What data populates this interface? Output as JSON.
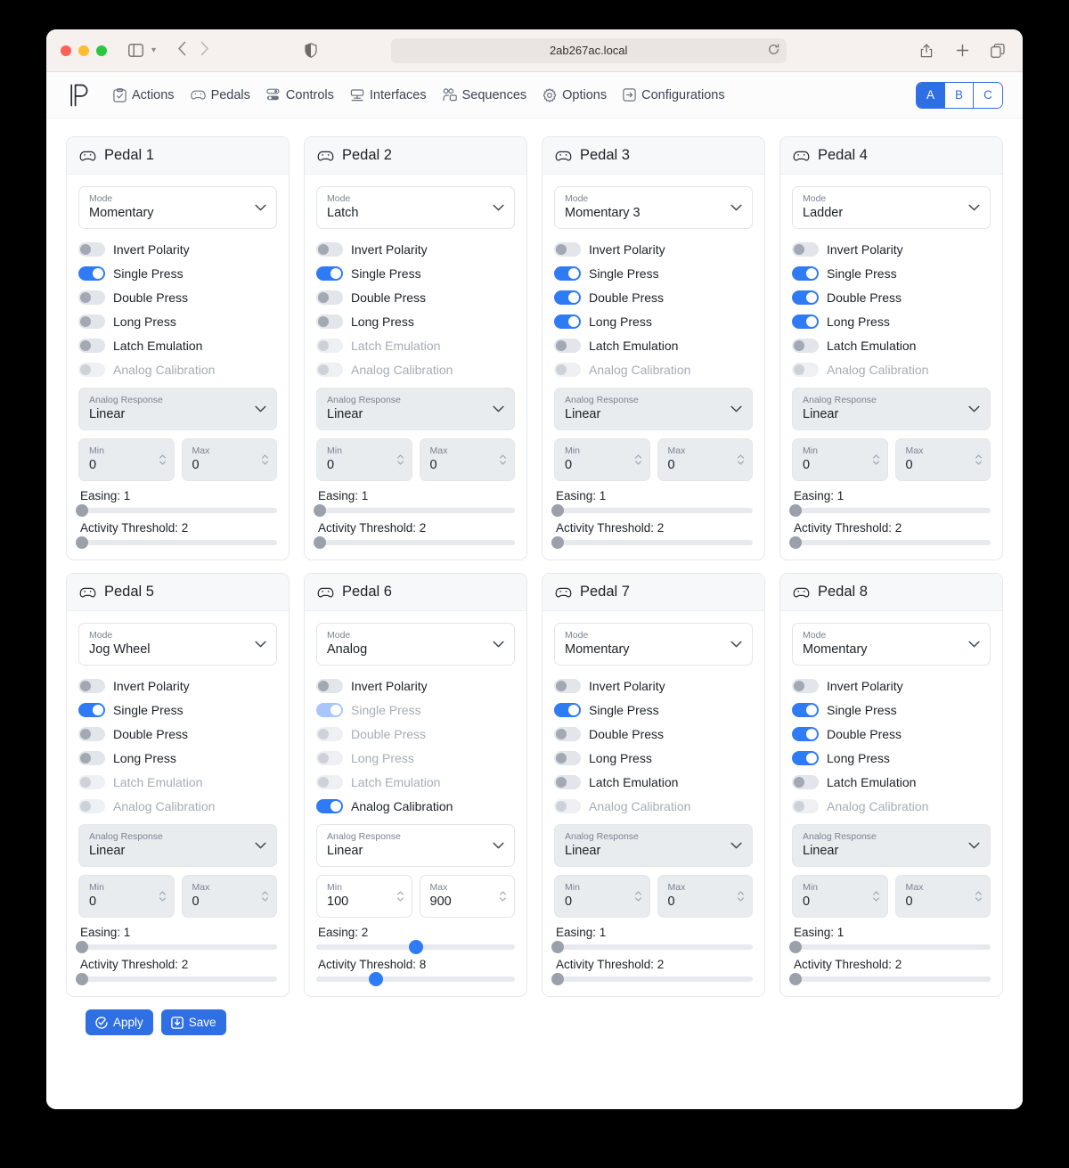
{
  "browser": {
    "url": "2ab267ac.local",
    "icons": {
      "sidebar": "sidebar-icon",
      "sidebar_chevron": "chevron-down-icon",
      "back": "back-arrow-icon",
      "forward": "forward-arrow-icon",
      "shield": "shield-icon",
      "reload": "reload-icon",
      "share": "share-icon",
      "new_tab": "plus-icon",
      "tabs": "tab-overview-icon"
    }
  },
  "nav": {
    "logo": "p-logo",
    "items": [
      {
        "label": "Actions",
        "icon": "clipboard-check-icon"
      },
      {
        "label": "Pedals",
        "icon": "gamepad-icon"
      },
      {
        "label": "Controls",
        "icon": "sliders-icon"
      },
      {
        "label": "Interfaces",
        "icon": "network-icon"
      },
      {
        "label": "Sequences",
        "icon": "video-stack-icon"
      },
      {
        "label": "Options",
        "icon": "gear-icon"
      },
      {
        "label": "Configurations",
        "icon": "chip-icon"
      }
    ],
    "configs": [
      {
        "label": "A",
        "active": true
      },
      {
        "label": "B",
        "active": false
      },
      {
        "label": "C",
        "active": false
      }
    ]
  },
  "labels": {
    "mode": "Mode",
    "analog_response": "Analog Response",
    "min": "Min",
    "max": "Max",
    "invert_polarity": "Invert Polarity",
    "single_press": "Single Press",
    "double_press": "Double Press",
    "long_press": "Long Press",
    "latch_emulation": "Latch Emulation",
    "analog_calibration": "Analog Calibration",
    "easing_prefix": "Easing",
    "activity_prefix": "Activity Threshold"
  },
  "footer": {
    "apply_label": "Apply",
    "apply_icon": "check-circle-icon",
    "save_label": "Save",
    "save_icon": "save-download-icon"
  },
  "colors": {
    "accent": "#2f6fe4",
    "toggle_on": "#2f7bf6",
    "toggle_off": "#e2e5ea",
    "card_border": "#e6e8eb",
    "card_header_bg": "#f7f8f9"
  },
  "pedals": [
    {
      "title": "Pedal 1",
      "icon": "gamepad-icon",
      "mode": "Momentary",
      "mode_enabled": true,
      "toggles": [
        {
          "key": "invert_polarity",
          "label": "Invert Polarity",
          "on": false,
          "enabled": true
        },
        {
          "key": "single_press",
          "label": "Single Press",
          "on": true,
          "enabled": true
        },
        {
          "key": "double_press",
          "label": "Double Press",
          "on": false,
          "enabled": true
        },
        {
          "key": "long_press",
          "label": "Long Press",
          "on": false,
          "enabled": true
        },
        {
          "key": "latch_emulation",
          "label": "Latch Emulation",
          "on": false,
          "enabled": true
        },
        {
          "key": "analog_calibration",
          "label": "Analog Calibration",
          "on": false,
          "enabled": false
        }
      ],
      "analog_response": "Linear",
      "analog_response_enabled": false,
      "min": "0",
      "max": "0",
      "minmax_enabled": false,
      "easing": 1,
      "easing_label": "Easing: 1",
      "easing_pct": 2,
      "easing_active": false,
      "activity": 2,
      "activity_label": "Activity Threshold: 2",
      "activity_pct": 2,
      "activity_active": false
    },
    {
      "title": "Pedal 2",
      "icon": "gamepad-icon",
      "mode": "Latch",
      "mode_enabled": true,
      "toggles": [
        {
          "key": "invert_polarity",
          "label": "Invert Polarity",
          "on": false,
          "enabled": true
        },
        {
          "key": "single_press",
          "label": "Single Press",
          "on": true,
          "enabled": true
        },
        {
          "key": "double_press",
          "label": "Double Press",
          "on": false,
          "enabled": true
        },
        {
          "key": "long_press",
          "label": "Long Press",
          "on": false,
          "enabled": true
        },
        {
          "key": "latch_emulation",
          "label": "Latch Emulation",
          "on": false,
          "enabled": false
        },
        {
          "key": "analog_calibration",
          "label": "Analog Calibration",
          "on": false,
          "enabled": false
        }
      ],
      "analog_response": "Linear",
      "analog_response_enabled": false,
      "min": "0",
      "max": "0",
      "minmax_enabled": false,
      "easing": 1,
      "easing_label": "Easing: 1",
      "easing_pct": 2,
      "easing_active": false,
      "activity": 2,
      "activity_label": "Activity Threshold: 2",
      "activity_pct": 2,
      "activity_active": false
    },
    {
      "title": "Pedal 3",
      "icon": "gamepad-icon",
      "mode": "Momentary 3",
      "mode_enabled": true,
      "toggles": [
        {
          "key": "invert_polarity",
          "label": "Invert Polarity",
          "on": false,
          "enabled": true
        },
        {
          "key": "single_press",
          "label": "Single Press",
          "on": true,
          "enabled": true
        },
        {
          "key": "double_press",
          "label": "Double Press",
          "on": true,
          "enabled": true
        },
        {
          "key": "long_press",
          "label": "Long Press",
          "on": true,
          "enabled": true
        },
        {
          "key": "latch_emulation",
          "label": "Latch Emulation",
          "on": false,
          "enabled": true
        },
        {
          "key": "analog_calibration",
          "label": "Analog Calibration",
          "on": false,
          "enabled": false
        }
      ],
      "analog_response": "Linear",
      "analog_response_enabled": false,
      "min": "0",
      "max": "0",
      "minmax_enabled": false,
      "easing": 1,
      "easing_label": "Easing: 1",
      "easing_pct": 2,
      "easing_active": false,
      "activity": 2,
      "activity_label": "Activity Threshold: 2",
      "activity_pct": 2,
      "activity_active": false
    },
    {
      "title": "Pedal 4",
      "icon": "gamepad-icon",
      "mode": "Ladder",
      "mode_enabled": true,
      "toggles": [
        {
          "key": "invert_polarity",
          "label": "Invert Polarity",
          "on": false,
          "enabled": true
        },
        {
          "key": "single_press",
          "label": "Single Press",
          "on": true,
          "enabled": true
        },
        {
          "key": "double_press",
          "label": "Double Press",
          "on": true,
          "enabled": true
        },
        {
          "key": "long_press",
          "label": "Long Press",
          "on": true,
          "enabled": true
        },
        {
          "key": "latch_emulation",
          "label": "Latch Emulation",
          "on": false,
          "enabled": true
        },
        {
          "key": "analog_calibration",
          "label": "Analog Calibration",
          "on": false,
          "enabled": false
        }
      ],
      "analog_response": "Linear",
      "analog_response_enabled": false,
      "min": "0",
      "max": "0",
      "minmax_enabled": false,
      "easing": 1,
      "easing_label": "Easing: 1",
      "easing_pct": 2,
      "easing_active": false,
      "activity": 2,
      "activity_label": "Activity Threshold: 2",
      "activity_pct": 2,
      "activity_active": false
    },
    {
      "title": "Pedal 5",
      "icon": "gamepad-icon",
      "mode": "Jog Wheel",
      "mode_enabled": true,
      "toggles": [
        {
          "key": "invert_polarity",
          "label": "Invert Polarity",
          "on": false,
          "enabled": true
        },
        {
          "key": "single_press",
          "label": "Single Press",
          "on": true,
          "enabled": true
        },
        {
          "key": "double_press",
          "label": "Double Press",
          "on": false,
          "enabled": true
        },
        {
          "key": "long_press",
          "label": "Long Press",
          "on": false,
          "enabled": true
        },
        {
          "key": "latch_emulation",
          "label": "Latch Emulation",
          "on": false,
          "enabled": false
        },
        {
          "key": "analog_calibration",
          "label": "Analog Calibration",
          "on": false,
          "enabled": false
        }
      ],
      "analog_response": "Linear",
      "analog_response_enabled": false,
      "min": "0",
      "max": "0",
      "minmax_enabled": false,
      "easing": 1,
      "easing_label": "Easing: 1",
      "easing_pct": 2,
      "easing_active": false,
      "activity": 2,
      "activity_label": "Activity Threshold: 2",
      "activity_pct": 2,
      "activity_active": false
    },
    {
      "title": "Pedal 6",
      "icon": "gamepad-icon",
      "mode": "Analog",
      "mode_enabled": true,
      "toggles": [
        {
          "key": "invert_polarity",
          "label": "Invert Polarity",
          "on": false,
          "enabled": true
        },
        {
          "key": "single_press",
          "label": "Single Press",
          "on": true,
          "enabled": false
        },
        {
          "key": "double_press",
          "label": "Double Press",
          "on": false,
          "enabled": false
        },
        {
          "key": "long_press",
          "label": "Long Press",
          "on": false,
          "enabled": false
        },
        {
          "key": "latch_emulation",
          "label": "Latch Emulation",
          "on": false,
          "enabled": false
        },
        {
          "key": "analog_calibration",
          "label": "Analog Calibration",
          "on": true,
          "enabled": true
        }
      ],
      "analog_response": "Linear",
      "analog_response_enabled": true,
      "min": "100",
      "max": "900",
      "minmax_enabled": true,
      "easing": 2,
      "easing_label": "Easing: 2",
      "easing_pct": 50,
      "easing_active": true,
      "activity": 8,
      "activity_label": "Activity Threshold: 8",
      "activity_pct": 30,
      "activity_active": true
    },
    {
      "title": "Pedal 7",
      "icon": "gamepad-icon",
      "mode": "Momentary",
      "mode_enabled": true,
      "toggles": [
        {
          "key": "invert_polarity",
          "label": "Invert Polarity",
          "on": false,
          "enabled": true
        },
        {
          "key": "single_press",
          "label": "Single Press",
          "on": true,
          "enabled": true
        },
        {
          "key": "double_press",
          "label": "Double Press",
          "on": false,
          "enabled": true
        },
        {
          "key": "long_press",
          "label": "Long Press",
          "on": false,
          "enabled": true
        },
        {
          "key": "latch_emulation",
          "label": "Latch Emulation",
          "on": false,
          "enabled": true
        },
        {
          "key": "analog_calibration",
          "label": "Analog Calibration",
          "on": false,
          "enabled": false
        }
      ],
      "analog_response": "Linear",
      "analog_response_enabled": false,
      "min": "0",
      "max": "0",
      "minmax_enabled": false,
      "easing": 1,
      "easing_label": "Easing: 1",
      "easing_pct": 2,
      "easing_active": false,
      "activity": 2,
      "activity_label": "Activity Threshold: 2",
      "activity_pct": 2,
      "activity_active": false
    },
    {
      "title": "Pedal 8",
      "icon": "gamepad-icon",
      "mode": "Momentary",
      "mode_enabled": true,
      "toggles": [
        {
          "key": "invert_polarity",
          "label": "Invert Polarity",
          "on": false,
          "enabled": true
        },
        {
          "key": "single_press",
          "label": "Single Press",
          "on": true,
          "enabled": true
        },
        {
          "key": "double_press",
          "label": "Double Press",
          "on": true,
          "enabled": true
        },
        {
          "key": "long_press",
          "label": "Long Press",
          "on": true,
          "enabled": true
        },
        {
          "key": "latch_emulation",
          "label": "Latch Emulation",
          "on": false,
          "enabled": true
        },
        {
          "key": "analog_calibration",
          "label": "Analog Calibration",
          "on": false,
          "enabled": false
        }
      ],
      "analog_response": "Linear",
      "analog_response_enabled": false,
      "min": "0",
      "max": "0",
      "minmax_enabled": false,
      "easing": 1,
      "easing_label": "Easing: 1",
      "easing_pct": 2,
      "easing_active": false,
      "activity": 2,
      "activity_label": "Activity Threshold: 2",
      "activity_pct": 2,
      "activity_active": false
    }
  ]
}
